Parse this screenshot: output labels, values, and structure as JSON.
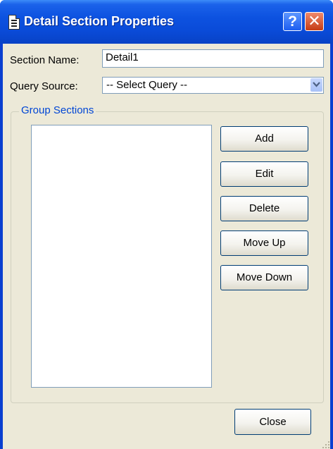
{
  "window": {
    "title": "Detail Section Properties",
    "help_glyph": "?",
    "close_glyph": "✕"
  },
  "section_name": {
    "label": "Section Name:",
    "value": "Detail1"
  },
  "query_source": {
    "label": "Query Source:",
    "selected": "-- Select Query --"
  },
  "group_sections": {
    "legend": "Group Sections",
    "items": [],
    "buttons": {
      "add": "Add",
      "edit": "Edit",
      "delete": "Delete",
      "move_up": "Move Up",
      "move_down": "Move Down"
    }
  },
  "footer": {
    "close_label": "Close"
  },
  "colors": {
    "title_bar": "#0a4bd8",
    "dialog_face": "#ece9d8",
    "group_legend": "#0046d5",
    "button_border": "#003c74"
  },
  "icons": {
    "title": "document-icon",
    "help": "help-icon",
    "close": "close-icon",
    "dropdown": "chevron-down-icon",
    "resize": "resize-grip-icon"
  }
}
